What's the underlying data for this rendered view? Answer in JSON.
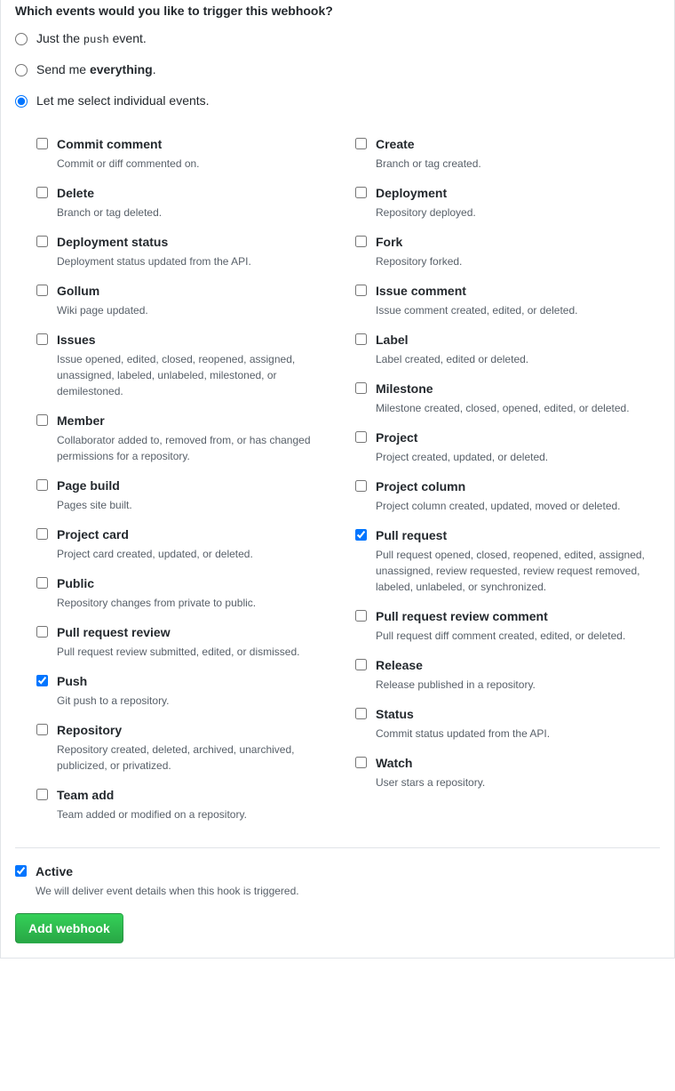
{
  "heading": "Which events would you like to trigger this webhook?",
  "radio": {
    "just_push_pre": "Just the ",
    "just_push_code": "push",
    "just_push_post": " event.",
    "send_everything_pre": "Send me ",
    "send_everything_bold": "everything",
    "send_everything_post": ".",
    "select_individual": "Let me select individual events."
  },
  "events_left": [
    {
      "title": "Commit comment",
      "desc": "Commit or diff commented on.",
      "checked": false
    },
    {
      "title": "Delete",
      "desc": "Branch or tag deleted.",
      "checked": false
    },
    {
      "title": "Deployment status",
      "desc": "Deployment status updated from the API.",
      "checked": false
    },
    {
      "title": "Gollum",
      "desc": "Wiki page updated.",
      "checked": false
    },
    {
      "title": "Issues",
      "desc": "Issue opened, edited, closed, reopened, assigned, unassigned, labeled, unlabeled, milestoned, or demilestoned.",
      "checked": false
    },
    {
      "title": "Member",
      "desc": "Collaborator added to, removed from, or has changed permissions for a repository.",
      "checked": false
    },
    {
      "title": "Page build",
      "desc": "Pages site built.",
      "checked": false
    },
    {
      "title": "Project card",
      "desc": "Project card created, updated, or deleted.",
      "checked": false
    },
    {
      "title": "Public",
      "desc": "Repository changes from private to public.",
      "checked": false
    },
    {
      "title": "Pull request review",
      "desc": "Pull request review submitted, edited, or dismissed.",
      "checked": false
    },
    {
      "title": "Push",
      "desc": "Git push to a repository.",
      "checked": true
    },
    {
      "title": "Repository",
      "desc": "Repository created, deleted, archived, unarchived, publicized, or privatized.",
      "checked": false
    },
    {
      "title": "Team add",
      "desc": "Team added or modified on a repository.",
      "checked": false
    }
  ],
  "events_right": [
    {
      "title": "Create",
      "desc": "Branch or tag created.",
      "checked": false
    },
    {
      "title": "Deployment",
      "desc": "Repository deployed.",
      "checked": false
    },
    {
      "title": "Fork",
      "desc": "Repository forked.",
      "checked": false
    },
    {
      "title": "Issue comment",
      "desc": "Issue comment created, edited, or deleted.",
      "checked": false
    },
    {
      "title": "Label",
      "desc": "Label created, edited or deleted.",
      "checked": false
    },
    {
      "title": "Milestone",
      "desc": "Milestone created, closed, opened, edited, or deleted.",
      "checked": false
    },
    {
      "title": "Project",
      "desc": "Project created, updated, or deleted.",
      "checked": false
    },
    {
      "title": "Project column",
      "desc": "Project column created, updated, moved or deleted.",
      "checked": false
    },
    {
      "title": "Pull request",
      "desc": "Pull request opened, closed, reopened, edited, assigned, unassigned, review requested, review request removed, labeled, unlabeled, or synchronized.",
      "checked": true
    },
    {
      "title": "Pull request review comment",
      "desc": "Pull request diff comment created, edited, or deleted.",
      "checked": false
    },
    {
      "title": "Release",
      "desc": "Release published in a repository.",
      "checked": false
    },
    {
      "title": "Status",
      "desc": "Commit status updated from the API.",
      "checked": false
    },
    {
      "title": "Watch",
      "desc": "User stars a repository.",
      "checked": false
    }
  ],
  "active": {
    "title": "Active",
    "desc": "We will deliver event details when this hook is triggered.",
    "checked": true
  },
  "submit_label": "Add webhook"
}
